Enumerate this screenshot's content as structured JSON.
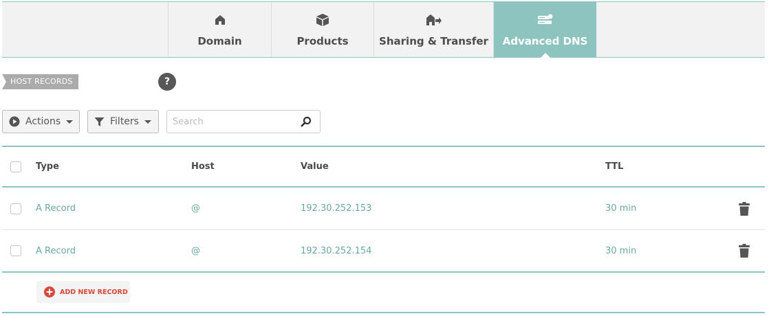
{
  "tabs": [
    {
      "label": "Domain",
      "icon": "home-icon",
      "active": false
    },
    {
      "label": "Products",
      "icon": "box-icon",
      "active": false
    },
    {
      "label": "Sharing & Transfer",
      "icon": "house-transfer-icon",
      "active": false
    },
    {
      "label": "Advanced DNS",
      "icon": "server-icon",
      "active": true
    }
  ],
  "section": {
    "title": "HOST RECORDS",
    "help_label": "?"
  },
  "toolbar": {
    "actions_label": "Actions",
    "filters_label": "Filters",
    "search_placeholder": "Search"
  },
  "table": {
    "headers": {
      "type": "Type",
      "host": "Host",
      "value": "Value",
      "ttl": "TTL"
    },
    "records": [
      {
        "type": "A Record",
        "host": "@",
        "value": "192.30.252.153",
        "ttl": "30 min"
      },
      {
        "type": "A Record",
        "host": "@",
        "value": "192.30.252.154",
        "ttl": "30 min"
      }
    ]
  },
  "add_record_label": "ADD NEW RECORD",
  "colors": {
    "accent": "#8ec4c0",
    "link_teal": "#6aa8a3",
    "add_red": "#d9463a",
    "tag_gray": "#ababab"
  }
}
